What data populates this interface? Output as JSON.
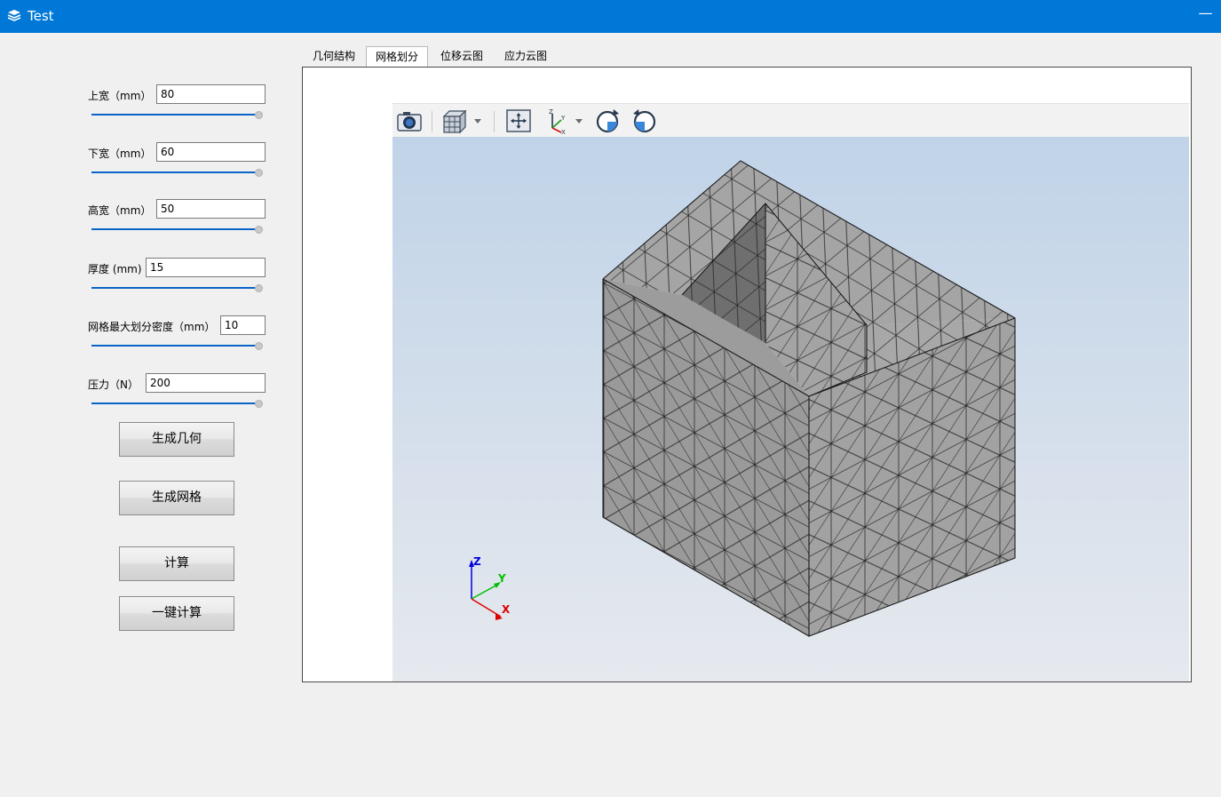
{
  "window": {
    "title": "Test",
    "minimize_glyph": "—"
  },
  "params": [
    {
      "label": "上宽（mm）",
      "value": "80"
    },
    {
      "label": "下宽（mm）",
      "value": "60"
    },
    {
      "label": "高宽（mm）",
      "value": "50"
    },
    {
      "label": "厚度 (mm)",
      "value": "15"
    },
    {
      "label": "网格最大划分密度（mm）",
      "value": "10"
    },
    {
      "label": "压力（N）",
      "value": "200"
    }
  ],
  "buttons": {
    "gen_geometry": "生成几何",
    "gen_mesh": "生成网格",
    "compute": "计算",
    "one_click": "一键计算"
  },
  "tabs": [
    {
      "label": "几何结构",
      "active": false
    },
    {
      "label": "网格划分",
      "active": true
    },
    {
      "label": "位移云图",
      "active": false
    },
    {
      "label": "应力云图",
      "active": false
    }
  ],
  "toolbar": [
    "camera-icon",
    "view-cube-icon",
    "fit-view-icon",
    "axes-orientation-icon",
    "rotate-cw-icon",
    "rotate-ccw-icon"
  ],
  "triad": {
    "x": "X",
    "y": "Y",
    "z": "Z"
  },
  "colors": {
    "titlebar": "#0078d7",
    "slider": "#0a64c8",
    "mesh_face": "#9c9c9c",
    "triad_x": "#e00000",
    "triad_y": "#00c000",
    "triad_z": "#0000e0"
  }
}
